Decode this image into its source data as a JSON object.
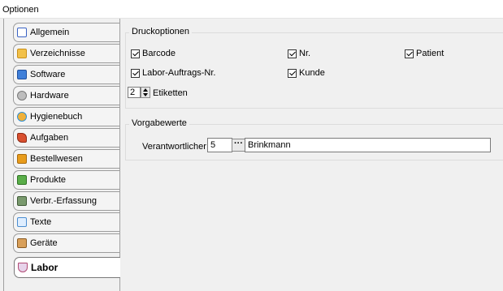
{
  "window": {
    "title": "Optionen"
  },
  "sidebar": {
    "items": [
      {
        "label": "Allgemein",
        "icon": "checklist-icon",
        "color": "#3a62c4"
      },
      {
        "label": "Verzeichnisse",
        "icon": "folder-icon",
        "color": "#e8a31f"
      },
      {
        "label": "Software",
        "icon": "download-icon",
        "color": "#2a66c9"
      },
      {
        "label": "Hardware",
        "icon": "gear-icon",
        "color": "#8b8b8b"
      },
      {
        "label": "Hygienebuch",
        "icon": "shield-icon",
        "color": "#2f8fd6"
      },
      {
        "label": "Aufgaben",
        "icon": "tasks-icon",
        "color": "#c7412a"
      },
      {
        "label": "Bestellwesen",
        "icon": "package-icon",
        "color": "#d88a13"
      },
      {
        "label": "Produkte",
        "icon": "products-icon",
        "color": "#4aa03f"
      },
      {
        "label": "Verbr.-Erfassung",
        "icon": "tap-icon",
        "color": "#5a7d4f"
      },
      {
        "label": "Texte",
        "icon": "text-document-icon",
        "color": "#4b8dd1"
      },
      {
        "label": "Geräte",
        "icon": "devices-icon",
        "color": "#c9893b"
      },
      {
        "label": "Labor",
        "icon": "lab-flask-icon",
        "color": "#b04a74"
      }
    ],
    "active": "Labor"
  },
  "druckoptionen": {
    "title": "Druckoptionen",
    "checkboxes": [
      {
        "label": "Barcode",
        "checked": true
      },
      {
        "label": "Nr.",
        "checked": true
      },
      {
        "label": "Patient",
        "checked": true
      },
      {
        "label": "Labor-Auftrags-Nr.",
        "checked": true
      },
      {
        "label": "Kunde",
        "checked": true
      }
    ],
    "copies_value": "2",
    "copies_label": "Etiketten"
  },
  "vorgabewerte": {
    "title": "Vorgabewerte",
    "responsible_label": "Verantwortlicher",
    "responsible_id": "5",
    "lookup_button": "···",
    "responsible_name": "Brinkmann"
  }
}
